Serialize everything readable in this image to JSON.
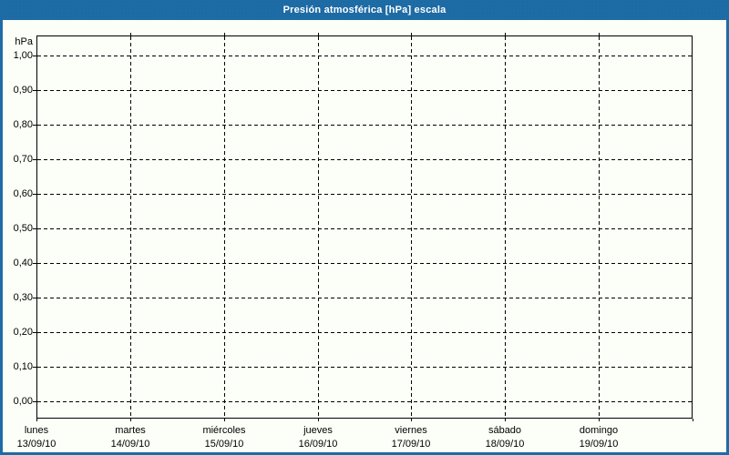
{
  "title_bar": {
    "title": "Presión atmosférica [hPa] escala"
  },
  "chart_data": {
    "type": "line",
    "title": "Presión atmosférica [hPa] escala",
    "ylabel": "hPa",
    "unit_label": "hPa",
    "ylim": [
      0.0,
      1.0
    ],
    "y_tick_step": 0.1,
    "y_tick_labels": [
      "1,00",
      "0,90",
      "0,80",
      "0,70",
      "0,60",
      "0,50",
      "0,40",
      "0,30",
      "0,20",
      "0,10",
      "0,00"
    ],
    "days": [
      {
        "name": "lunes",
        "date": "13/09/10"
      },
      {
        "name": "martes",
        "date": "14/09/10"
      },
      {
        "name": "miércoles",
        "date": "15/09/10"
      },
      {
        "name": "jueves",
        "date": "16/09/10"
      },
      {
        "name": "viernes",
        "date": "17/09/10"
      },
      {
        "name": "sábado",
        "date": "18/09/10"
      },
      {
        "name": "domingo",
        "date": "19/09/10"
      }
    ],
    "series": [],
    "grid": "dashed",
    "legend_position": "none"
  },
  "colors": {
    "accent_blue": "#1E6CA6",
    "background": "#FCFFF7",
    "grid": "#000000",
    "title_text": "#FFFFFF"
  }
}
